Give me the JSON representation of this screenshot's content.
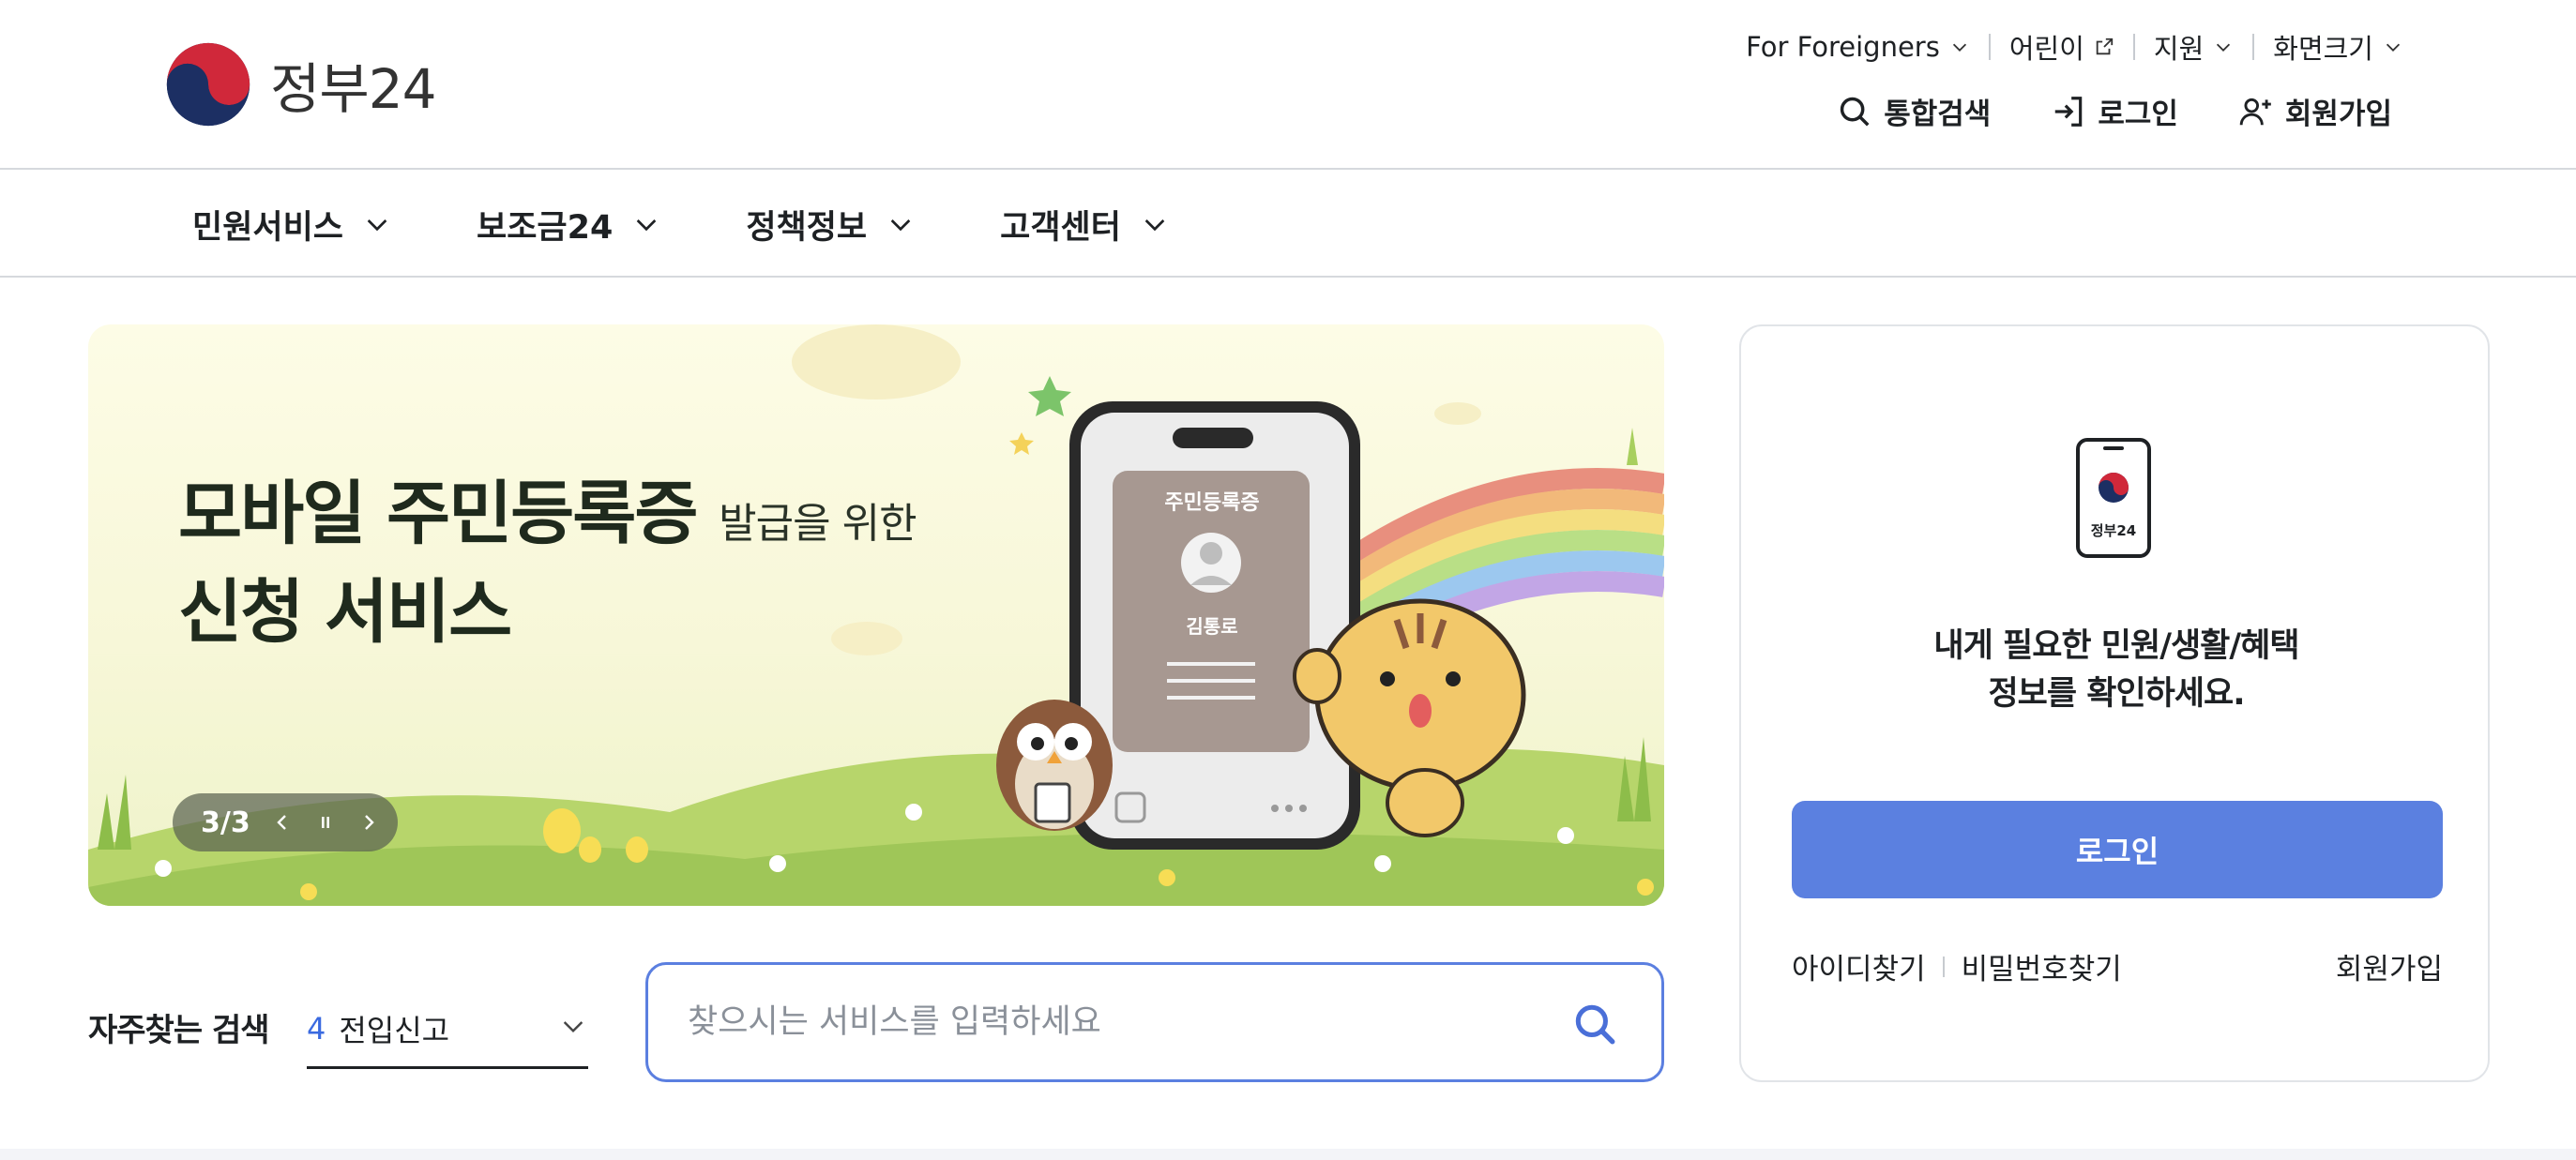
{
  "header": {
    "logo_text": "정부24",
    "util": [
      {
        "label": "For Foreigners",
        "icon": "chevron-down-icon"
      },
      {
        "label": "어린이",
        "icon": "external-link-icon"
      },
      {
        "label": "지원",
        "icon": "chevron-down-icon"
      },
      {
        "label": "화면크기",
        "icon": "chevron-down-icon"
      }
    ],
    "actions": [
      {
        "label": "통합검색",
        "icon": "search-icon"
      },
      {
        "label": "로그인",
        "icon": "login-icon"
      },
      {
        "label": "회원가입",
        "icon": "user-add-icon"
      }
    ]
  },
  "gnb": {
    "items": [
      {
        "label": "민원서비스"
      },
      {
        "label": "보조금24"
      },
      {
        "label": "정책정보"
      },
      {
        "label": "고객센터"
      }
    ]
  },
  "banner": {
    "title_main": "모바일 주민등록증",
    "title_small": "발급을 위한",
    "title_line2": "신청 서비스",
    "card_title": "주민등록증",
    "card_name": "김통로",
    "pager_text": "3/3"
  },
  "frequent_search": {
    "label": "자주찾는 검색",
    "selected_number": "4",
    "selected_value": "전입신고"
  },
  "search": {
    "placeholder": "찾으시는 서비스를 입력하세요"
  },
  "login_panel": {
    "phone_label": "정부24",
    "message_line1": "내게 필요한 민원/생활/혜택",
    "message_line2": "정보를 확인하세요.",
    "login_button": "로그인",
    "find_id": "아이디찾기",
    "find_password": "비밀번호찾기",
    "signup": "회원가입"
  },
  "colors": {
    "primary_blue": "#5b80e0",
    "search_border": "#5b7fe0",
    "text": "#1e2124",
    "banner_bg": "#fdfce6"
  }
}
